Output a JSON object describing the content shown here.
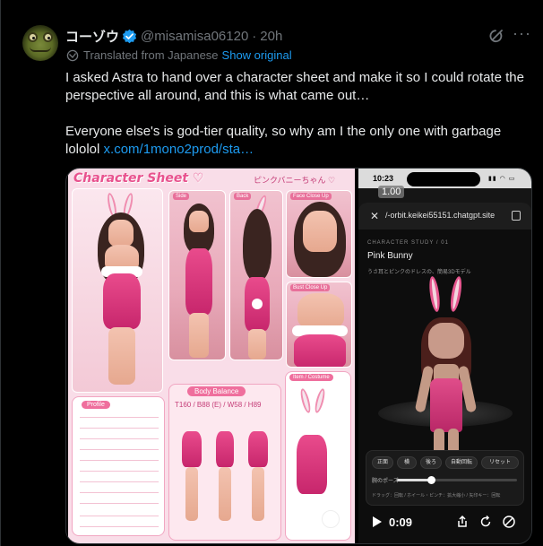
{
  "tweet": {
    "author_name": "コーゾウ",
    "handle": "@misamisa06120",
    "separator": "·",
    "time": "20h",
    "translated_label": "Translated from Japanese",
    "show_original": "Show original",
    "paragraph1": "I asked Astra to hand over a character sheet and make it so I could rotate the perspective all around, and this is what came out…",
    "paragraph2_text": "Everyone else's is god-tier quality, so why am I the only one with garbage lololol ",
    "paragraph2_link": "x.com/1mono2prod/sta…"
  },
  "sheet": {
    "title": "Character Sheet ♡",
    "subtitle": "ピンクバニーちゃん ♡",
    "tag_side": "Side",
    "tag_back": "Back",
    "tag_face": "Face Close Up",
    "tag_bust": "Bust Close Up",
    "profile": "Profile",
    "body_balance": "Body Balance",
    "measurements": "T160 / B88 (E) / W58 / H89",
    "item_costume": "Item / Costume"
  },
  "phone": {
    "status_time": "10:23",
    "zoom": "1.00",
    "url": "/-orbit.keikei55151.chatgpt.site",
    "study_label": "CHARACTER STUDY / 01",
    "study_title": "Pink Bunny",
    "study_sub": "うさ耳とピンクのドレスの、簡易3Dモデル",
    "buttons": [
      "正面",
      "横",
      "後ろ",
      "自動回転",
      "リセット"
    ],
    "pose_label": "腕のポーズ",
    "pose_level": 0.28,
    "hint": "ドラッグ：回転 / ホイール・ピンチ：拡大縮小 / 矢印キー：回転",
    "video_time": "0:09"
  },
  "colors": {
    "link": "#1d9bf0",
    "verified": "#1d9bf0",
    "muted": "#71767b",
    "pink": "#e8528e"
  }
}
